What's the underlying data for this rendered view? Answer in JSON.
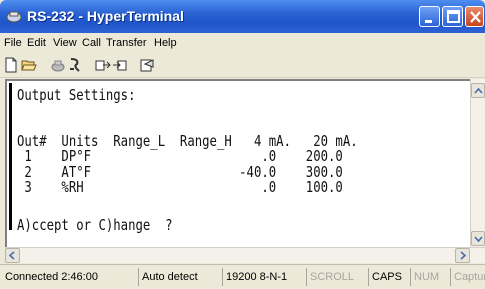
{
  "window": {
    "title": "RS-232 - HyperTerminal"
  },
  "menu": [
    "File",
    "Edit",
    "View",
    "Call",
    "Transfer",
    "Help"
  ],
  "toolbar": {
    "icons": [
      "new-icon",
      "open-icon",
      "disconnect-icon",
      "dial-icon",
      "send-icon",
      "receive-icon",
      "properties-icon"
    ]
  },
  "terminal": {
    "lines": [
      "Output Settings:",
      "",
      "Out#  Units  Range_L  Range_H   4 mA.   20 mA.",
      " 1    DP°F                       .0    200.0",
      " 2    AT°F                    -40.0    300.0",
      " 3    %RH                        .0    100.0",
      "",
      "A)ccept or C)hange  ?"
    ]
  },
  "status": {
    "connected": "Connected 2:46:00",
    "detect": "Auto detect",
    "settings": "19200 8-N-1",
    "scroll": "SCROLL",
    "caps": "CAPS",
    "num": "NUM",
    "capture": "Captur"
  },
  "colors": {
    "titlebar": "#2a63d4",
    "close": "#c8441c"
  }
}
